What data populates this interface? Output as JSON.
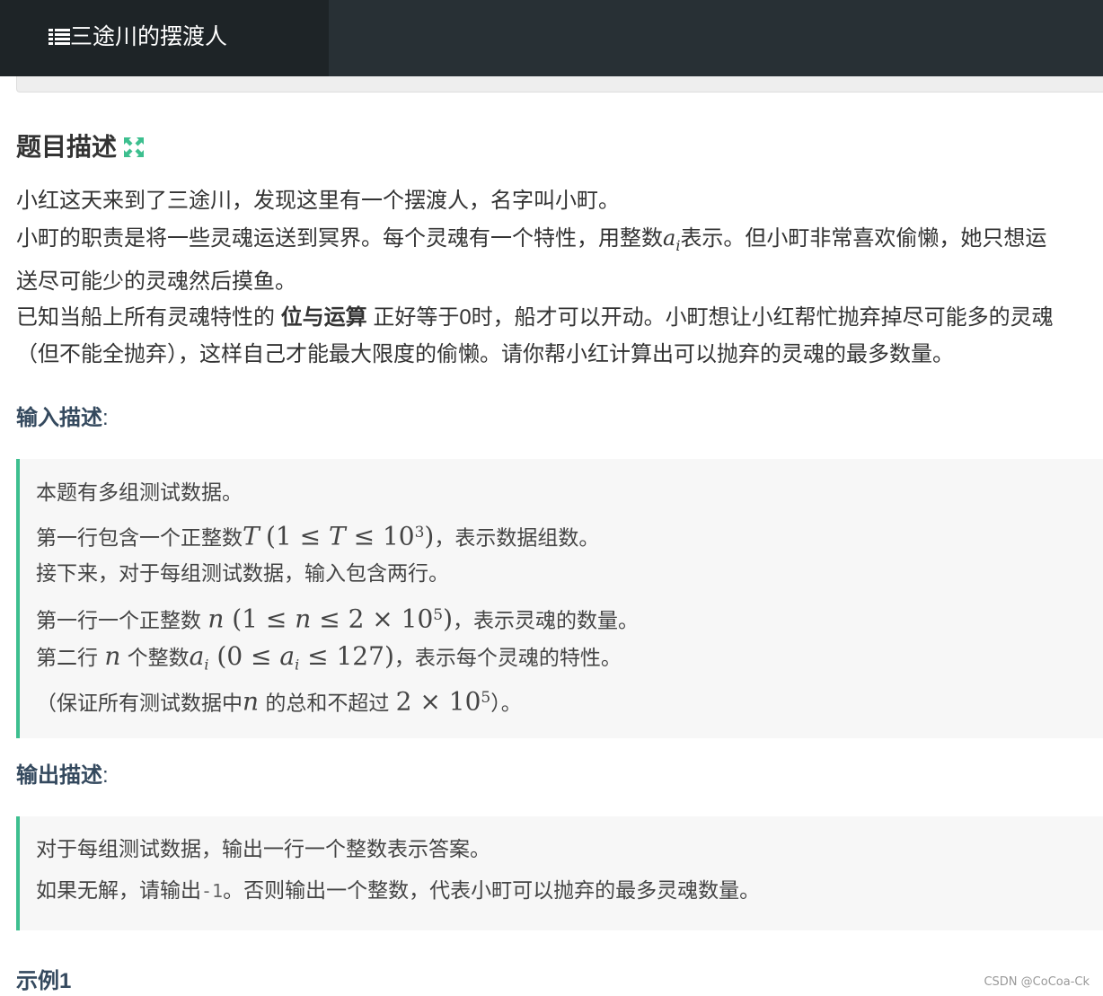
{
  "header": {
    "title": "三途川的摆渡人"
  },
  "problem": {
    "heading": "题目描述",
    "lines": {
      "l1": "小红这天来到了三途川，发现这里有一个摆渡人，名字叫小町。",
      "l2a": "小町的职责是将一些灵魂运送到冥界。每个灵魂有一个特性，用整数",
      "l2_var": "a",
      "l2_sub": "i",
      "l2b": "表示。但小町非常喜欢偷懒，她只想运",
      "l3": "送尽可能少的灵魂然后摸鱼。",
      "l4a": "已知当船上所有灵魂特性的 ",
      "l4_bold": "位与运算",
      "l4b": " 正好等于0时，船才可以开动。小町想让小红帮忙抛弃掉尽可能多的灵魂",
      "l5": "（但不能全抛弃），这样自己才能最大限度的偷懒。请你帮小红计算出可以抛弃的灵魂的最多数量。"
    }
  },
  "input_section": {
    "heading": "输入描述",
    "colon": ":",
    "lines": {
      "l1": "本题有多组测试数据。",
      "l2a": "第一行包含一个正整数",
      "l2_var": "T",
      "l2_math": "(1 ≤ ",
      "l2_var2": "T",
      "l2_math2": " ≤ 10",
      "l2_exp": "3",
      "l2_math3": ")",
      "l2b": "，表示数据组数。",
      "l3": "接下来，对于每组测试数据，输入包含两行。",
      "l4a": "第一行一个正整数 ",
      "l4_var": "n",
      "l4_math": " (1 ≤ ",
      "l4_var2": "n",
      "l4_math2": " ≤ 2 × 10",
      "l4_exp": "5",
      "l4_math3": ")",
      "l4b": "，表示灵魂的数量。",
      "l5a": "第二行 ",
      "l5_var": "n",
      "l5b": " 个整数",
      "l5_var2": "a",
      "l5_sub": "i",
      "l5_math": " (0 ≤ ",
      "l5_var3": "a",
      "l5_sub2": "i",
      "l5_math2": " ≤ 127)",
      "l5c": "，表示每个灵魂的特性。",
      "l6a": "（保证所有测试数据中",
      "l6_var": "n",
      "l6b": " 的总和不超过 ",
      "l6_math": "2 × 10",
      "l6_exp": "5",
      "l6c": "）。"
    }
  },
  "output_section": {
    "heading": "输出描述",
    "colon": ":",
    "lines": {
      "l1": "对于每组测试数据，输出一行一个整数表示答案。",
      "l2a": "如果无解，请输出",
      "l2_code": "-1",
      "l2b": "。否则输出一个整数，代表小町可以抛弃的最多灵魂数量。"
    }
  },
  "example_heading": "示例1",
  "watermark": "CSDN @CoCoa-Ck",
  "colors": {
    "topbar": "#283035",
    "brand_bg": "#1e2427",
    "accent": "#3dbf8f",
    "section_heading": "#34495e"
  },
  "icons": {
    "brand": "list-icon",
    "expand": "expand-arrows-icon"
  }
}
